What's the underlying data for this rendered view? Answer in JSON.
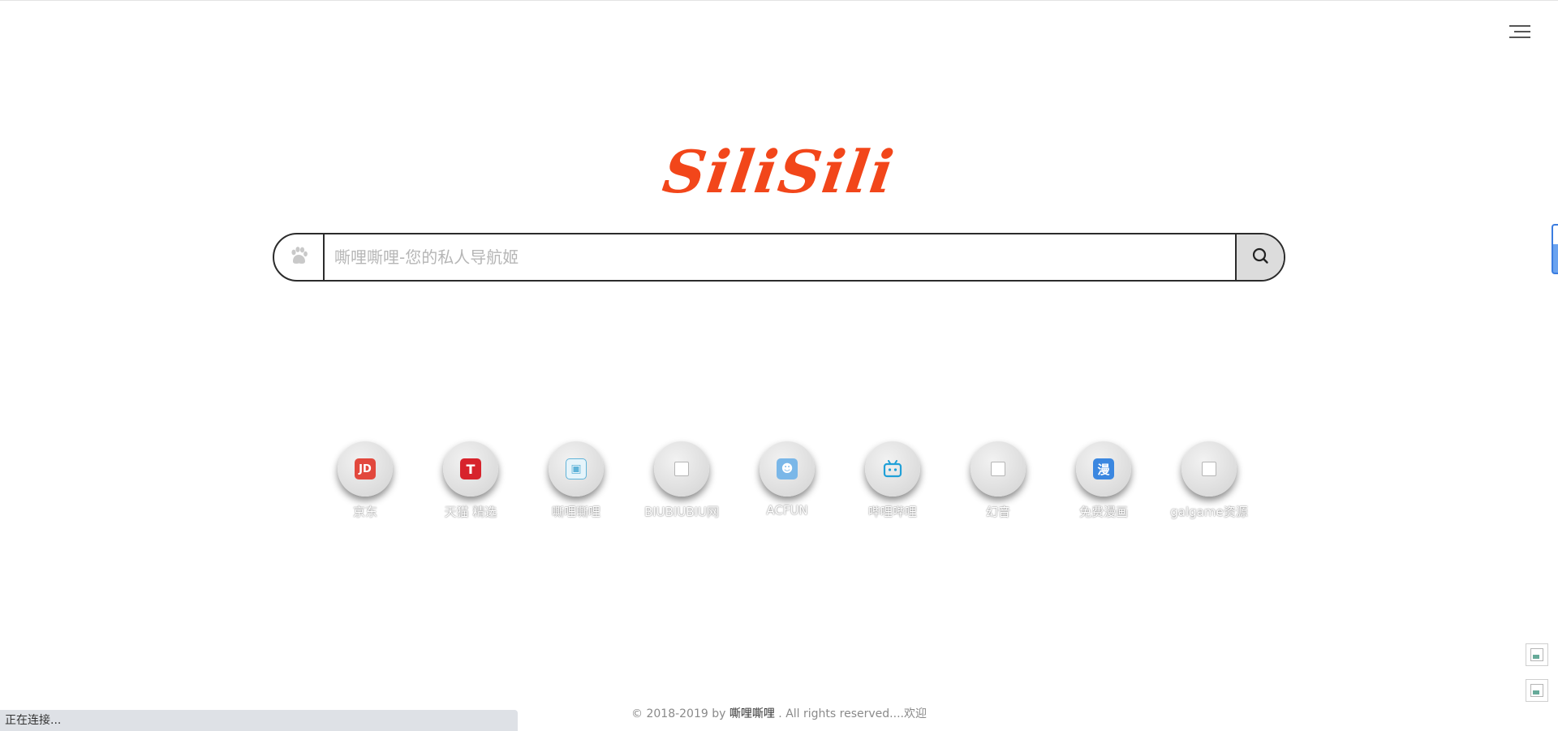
{
  "header": {
    "menu_icon": "hamburger-menu-icon"
  },
  "logo": {
    "text": "SiliSili",
    "color": "#f2461a"
  },
  "search": {
    "engine_icon": "baidu-paw-icon",
    "placeholder": "嘶哩嘶哩-您的私人导航姬",
    "value": "",
    "submit_icon": "search-icon"
  },
  "links": [
    {
      "label": "京东",
      "icon": "jd-icon",
      "glyph": "JD"
    },
    {
      "label": "天猫 精选",
      "icon": "tmall-icon",
      "glyph": "T"
    },
    {
      "label": "嘶哩嘶哩",
      "icon": "sili-icon",
      "glyph": "▣"
    },
    {
      "label": "BIUBIUBIU网",
      "icon": "broken-image-icon",
      "glyph": ""
    },
    {
      "label": "ACFUN",
      "icon": "acfun-icon",
      "glyph": "☻"
    },
    {
      "label": "哔哩哔哩",
      "icon": "bilibili-icon",
      "glyph": "📺"
    },
    {
      "label": "幻音",
      "icon": "broken-image-icon",
      "glyph": ""
    },
    {
      "label": "免费漫画",
      "icon": "manga-icon",
      "glyph": "漫"
    },
    {
      "label": "galgame资源",
      "icon": "broken-image-icon",
      "glyph": ""
    }
  ],
  "footer": {
    "prefix": "© 2018-2019 by ",
    "brand": "嘶哩嘶哩",
    "suffix": " . All rights reserved....欢迎"
  },
  "status_bar": {
    "text": "正在连接..."
  },
  "side_buttons": [
    {
      "icon": "broken-image-icon"
    },
    {
      "icon": "broken-image-icon"
    }
  ]
}
